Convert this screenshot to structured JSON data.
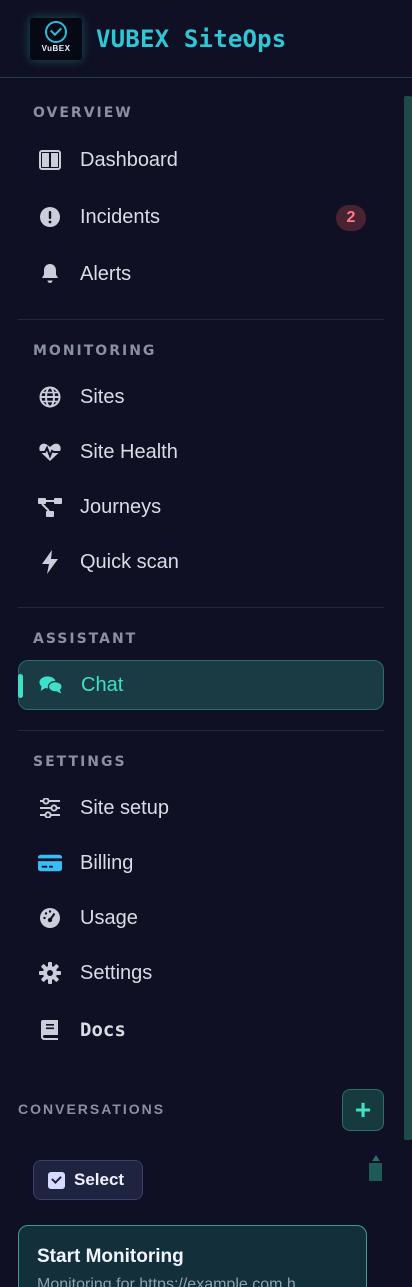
{
  "app": {
    "brand": "VUBEX SiteOps",
    "logo_text": "VuBEX"
  },
  "sections": {
    "overview": "OVERVIEW",
    "monitoring": "MONITORING",
    "assistant": "ASSISTANT",
    "settings": "SETTINGS",
    "conversations": "CONVERSATIONS"
  },
  "nav": {
    "dashboard": "Dashboard",
    "incidents": "Incidents",
    "incidents_badge": "2",
    "alerts": "Alerts",
    "sites": "Sites",
    "site_health": "Site Health",
    "journeys": "Journeys",
    "quick_scan": "Quick scan",
    "chat": "Chat",
    "site_setup": "Site setup",
    "billing": "Billing",
    "usage": "Usage",
    "settings": "Settings",
    "docs": "Docs"
  },
  "conversations": {
    "add_label": "+",
    "select_label": "Select",
    "items": [
      {
        "title": "Start Monitoring",
        "preview": "Monitoring for https://example.com h"
      }
    ]
  },
  "colors": {
    "accent": "#3ee0c9",
    "brand": "#2fc6d6",
    "badge": "#ff7a8c",
    "background": "#0f1023"
  }
}
